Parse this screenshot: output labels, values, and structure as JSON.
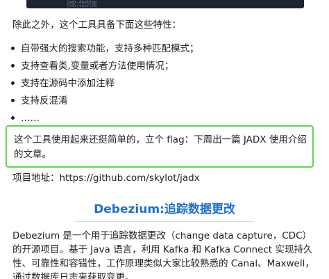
{
  "top_strip": {
    "line1": "jadx-desktop",
    "line2": "jadx/sources"
  },
  "intro": "除此之外，这个工具具备下面这些特性：",
  "features": [
    "自带强大的搜索功能，支持多种匹配模式；",
    "支持查看类,变量或者方法使用情况；",
    "支持在源码中添加注释",
    "支持反混淆",
    "……"
  ],
  "highlight": {
    "text": "这个工具使用起来还挺简单的，立个 flag：下周出一篇 JADX 使用介绍的文章。",
    "border_color": "#5fd45a"
  },
  "project_address": "项目地址：https://github.com/skylot/jadx",
  "section_title": "Debezium:追踪数据更改",
  "section_title_color": "#1e6fc6",
  "description": "Debezium 是一个用于追踪数据更改（change data capture，CDC）的开源项目。基于 Java 语言，利用 Kafka 和 Kafka Connect 实现持久性、可靠性和容错性，工作原理类似大家比较熟悉的 Canal、Maxwell，通过数据库日志来获取变更。"
}
